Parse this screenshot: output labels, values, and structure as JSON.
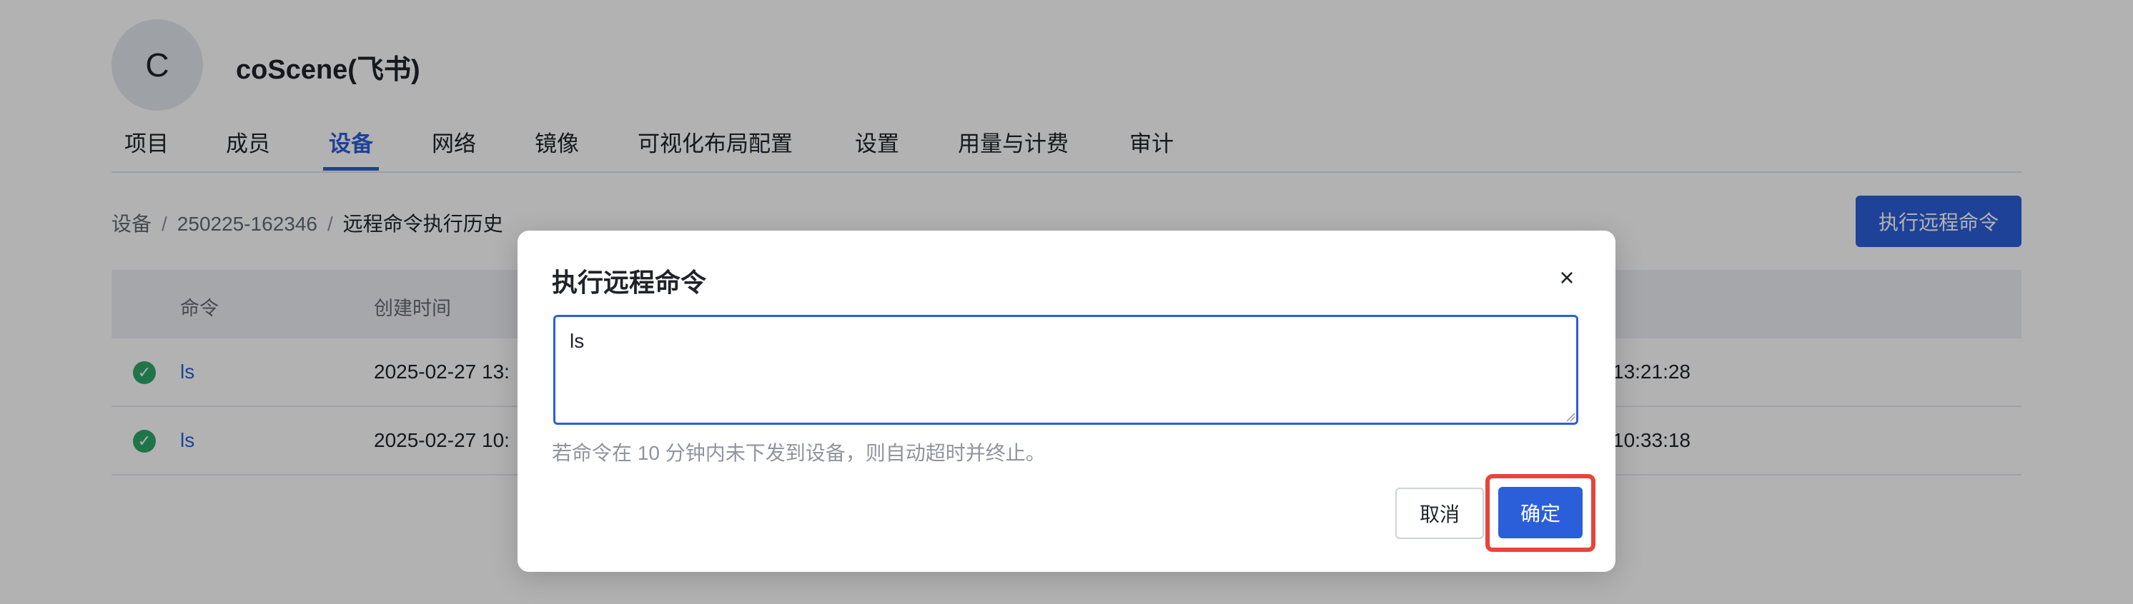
{
  "org": {
    "avatar_letter": "C",
    "name": "coScene(飞书)"
  },
  "tabs": [
    {
      "label": "项目"
    },
    {
      "label": "成员"
    },
    {
      "label": "设备",
      "active": true
    },
    {
      "label": "网络"
    },
    {
      "label": "镜像"
    },
    {
      "label": "可视化布局配置"
    },
    {
      "label": "设置"
    },
    {
      "label": "用量与计费"
    },
    {
      "label": "审计"
    }
  ],
  "breadcrumb": [
    "设备",
    "250225-162346",
    "远程命令执行历史"
  ],
  "breadcrumb_separator": "/",
  "header_action": {
    "label": "执行远程命令"
  },
  "table": {
    "columns": [
      "命令",
      "创建时间"
    ],
    "rows": [
      {
        "command": "ls",
        "created": "2025-02-27 13:",
        "end_time": "13:21:28",
        "status": "success"
      },
      {
        "command": "ls",
        "created": "2025-02-27 10:",
        "end_time": "10:33:18",
        "status": "success"
      }
    ]
  },
  "modal": {
    "title": "执行远程命令",
    "close_icon": "×",
    "command_value": "ls",
    "hint": "若命令在 10 分钟内未下发到设备，则自动超时并终止。",
    "cancel_label": "取消",
    "confirm_label": "确定",
    "highlight_color": "#e8443a"
  },
  "colors": {
    "primary": "#2b5fd9",
    "success": "#2ea66a"
  }
}
